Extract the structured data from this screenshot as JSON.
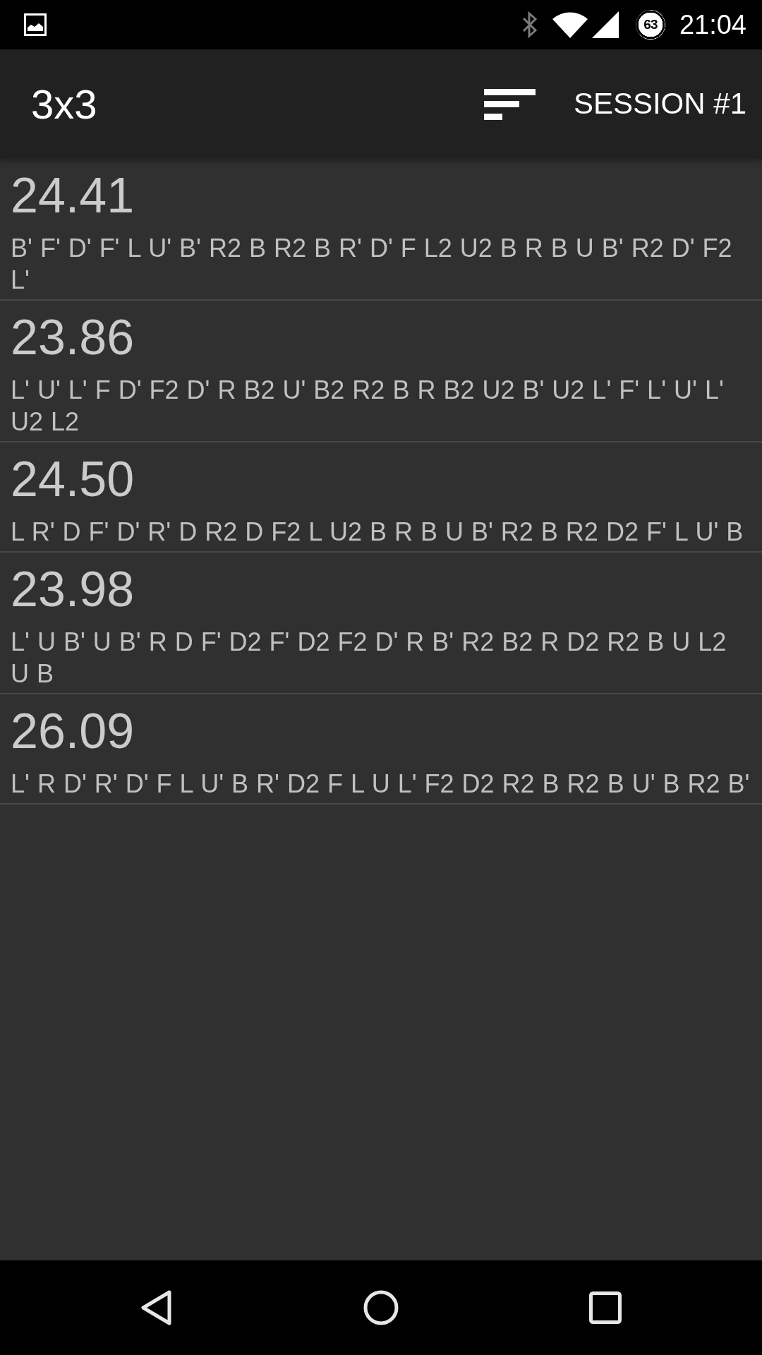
{
  "status_bar": {
    "battery_percent": "63",
    "time": "21:04"
  },
  "app_bar": {
    "title": "3x3",
    "session_button": "SESSION #1"
  },
  "solves": [
    {
      "time": "24.41",
      "scramble": "B' F' D' F' L U' B' R2 B R2 B R' D' F L2 U2 B R B U B' R2 D' F2 L'"
    },
    {
      "time": "23.86",
      "scramble": "L' U' L' F D' F2 D' R B2 U' B2 R2 B R B2 U2 B' U2 L' F' L' U' L' U2 L2"
    },
    {
      "time": "24.50",
      "scramble": "L R' D F' D' R' D R2 D F2 L U2 B R B U B' R2 B R2 D2 F' L U' B"
    },
    {
      "time": "23.98",
      "scramble": "L' U B' U B' R D F' D2 F' D2 F2 D' R B' R2 B2 R D2 R2 B U L2 U B"
    },
    {
      "time": "26.09",
      "scramble": "L' R D' R' D' F L U' B R' D2 F L U L' F2 D2 R2 B R2 B U' B R2 B'"
    }
  ]
}
